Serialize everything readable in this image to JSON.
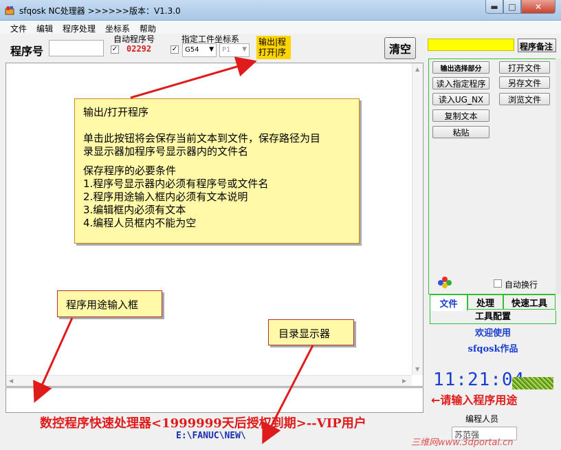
{
  "window": {
    "title": "sfqosk NC处理器 >>>>>>版本：V1.3.0",
    "min_glyph": "▬",
    "max_glyph": "□",
    "close_glyph": "✕"
  },
  "menu": [
    "文件",
    "编辑",
    "程序处理",
    "坐标系",
    "帮助"
  ],
  "toolbar": {
    "program_no_label": "程序号",
    "program_no_value": "",
    "auto_program_label": "自动程序号",
    "auto_program_checked": true,
    "auto_program_value": "02292",
    "coord_label": "指定工件坐标系",
    "coord_checked": true,
    "coord_value": "G54",
    "p_value": "P1",
    "output_open_label_line1": "输出|程",
    "output_open_label_line2": "打开|序",
    "clear_label": "清空"
  },
  "editor": {
    "text": "",
    "purpose_value": ""
  },
  "footer": {
    "title": "数控程序快速处理器<1999999天后授权到期>--VIP用户",
    "directory": "E:\\FANUC\\NEW\\"
  },
  "right_panel": {
    "note_button": "程序备注",
    "buttons_left": [
      "输出选择部分",
      "读入指定程序",
      "读入UG_NX",
      "复制文本",
      "粘贴"
    ],
    "buttons_right": [
      "打开文件",
      "另存文件",
      "浏览文件"
    ],
    "auto_wrap_label": "自动换行",
    "auto_wrap_checked": false,
    "tabs": [
      "文件",
      "处理",
      "快速工具"
    ],
    "tools_config": "工具配置",
    "welcome": "欢迎使用",
    "author": "sfqosk作品",
    "clock": "11:21:04",
    "purpose_hint": "←请输入程序用途",
    "programmer_label": "编程人员",
    "programmer_value": "苏范强",
    "watermark": "三维网www.3dportal.cn"
  },
  "callouts": {
    "main_title": "输出/打开程序",
    "main_line1": "单击此按钮将会保存当前文本到文件，保存路径为目",
    "main_line2": "录显示器加程序号显示器内的文件名",
    "main_cond_title": "保存程序的必要条件",
    "main_cond1": "1.程序号显示器内必须有程序号或文件名",
    "main_cond2": "2.程序用途输入框内必须有文本说明",
    "main_cond3": "3.编辑框内必须有文本",
    "main_cond4": "4.编程人员框内不能为空",
    "purpose_box": "程序用途输入框",
    "dir_box": "目录显示器"
  },
  "colors": {
    "accent_blue": "#1a3fd0",
    "alert_red": "#e01b1b",
    "highlight_yellow": "#ffd400",
    "callout_bg": "#fff9a8",
    "panel_green": "#30c030"
  }
}
